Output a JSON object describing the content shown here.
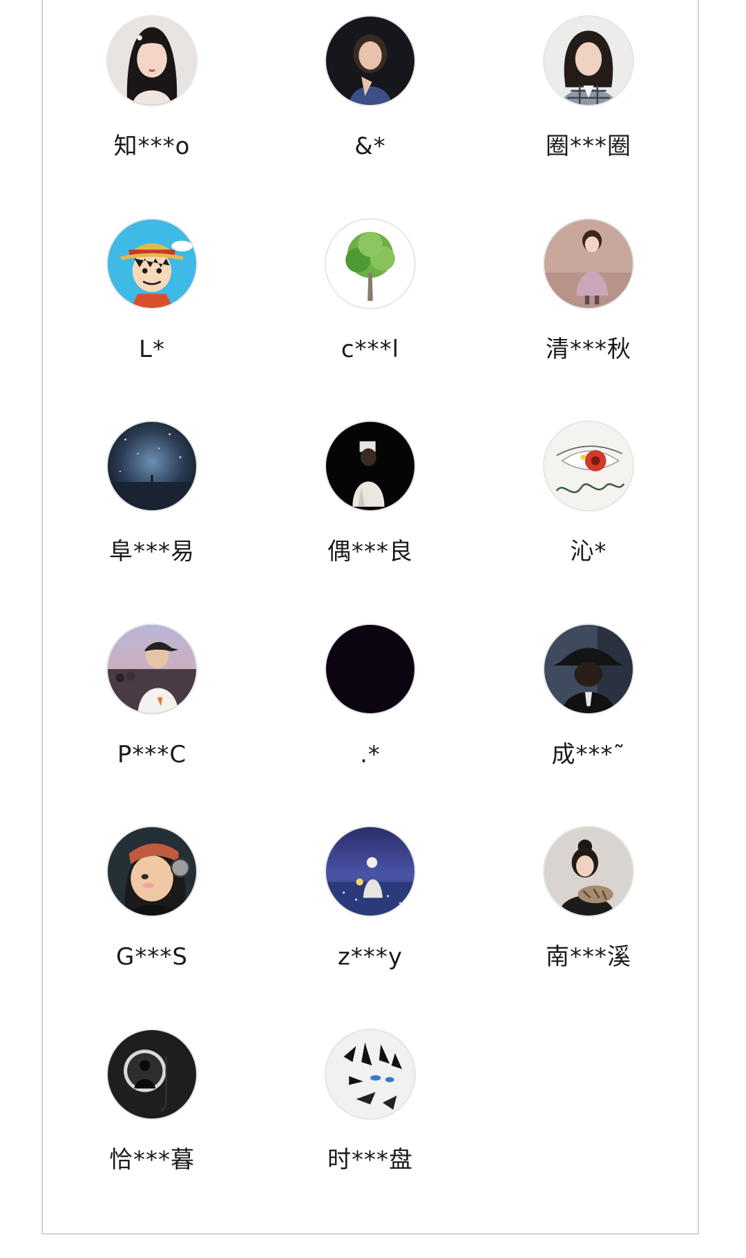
{
  "users": [
    {
      "name": "知***o",
      "avatar": "portrait-girl-hair-accessory"
    },
    {
      "name": "&*",
      "avatar": "portrait-girl-dark-background"
    },
    {
      "name": "圈***圈",
      "avatar": "portrait-girl-plaid-shirt"
    },
    {
      "name": "L*",
      "avatar": "cartoon-straw-hat-boy"
    },
    {
      "name": "c***l",
      "avatar": "green-tree"
    },
    {
      "name": "清***秋",
      "avatar": "little-girl-pink-coat"
    },
    {
      "name": "阜***易",
      "avatar": "starry-sky-silhouette"
    },
    {
      "name": "偶***良",
      "avatar": "girl-dark-background-white-outfit"
    },
    {
      "name": "沁*",
      "avatar": "eye-sketch-flag"
    },
    {
      "name": "P***C",
      "avatar": "boy-with-cap-crowd"
    },
    {
      "name": ".*",
      "avatar": "solid-black"
    },
    {
      "name": "成***˜",
      "avatar": "person-black-hat"
    },
    {
      "name": "G***S",
      "avatar": "anime-boy-goggles"
    },
    {
      "name": "z***y",
      "avatar": "anime-figure-night-field"
    },
    {
      "name": "南***溪",
      "avatar": "girl-holding-cat"
    },
    {
      "name": "恰***暮",
      "avatar": "silhouette-keyhole-dark"
    },
    {
      "name": "时***盘",
      "avatar": "anime-sketch-black-white"
    }
  ]
}
